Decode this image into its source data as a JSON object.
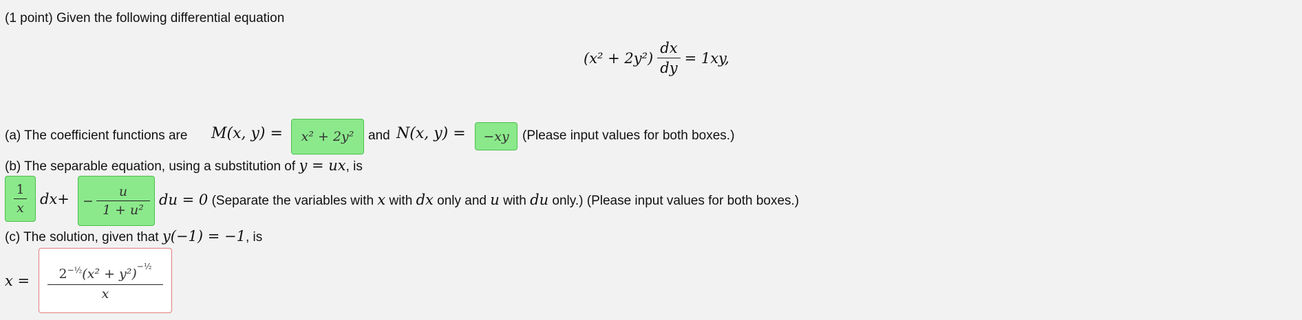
{
  "problem": {
    "intro": "(1 point) Given the following differential equation",
    "equation": {
      "lhs_paren": "(x² + 2y²)",
      "deriv_num": "dx",
      "deriv_den": "dy",
      "rhs": "= 1xy,"
    }
  },
  "part_a": {
    "text_before": "(a) The coefficient functions are",
    "m_label": "M(x, y) =",
    "m_answer": "x² + 2y²",
    "and_text": "and",
    "n_label": "N(x, y) =",
    "n_answer": "−xy",
    "note": "(Please input values for both boxes.)"
  },
  "part_b": {
    "text": "(b) The separable equation, using a substitution of",
    "subst": "y = ux",
    "is_text": ", is",
    "ans1_num": "1",
    "ans1_den": "x",
    "dx_plus": "dx+",
    "ans2_sign": "−",
    "ans2_num": "u",
    "ans2_den": "1 + u²",
    "du_zero": "du = 0",
    "note_prefix": "(Separate the variables with",
    "note_x": "x",
    "note_with1": "with",
    "note_dx": "dx",
    "note_only_and": "only and",
    "note_u": "u",
    "note_with2": "with",
    "note_du": "du",
    "note_suffix": "only.) (Please input values for both boxes.)"
  },
  "part_c": {
    "text": "(c) The solution, given that",
    "condition": "y(−1) = −1",
    "is_text": ", is",
    "x_label": "x =",
    "answer_base": "2",
    "answer_exp1": "−½",
    "answer_paren": "(x² + y²)",
    "answer_exp2": "−½",
    "answer_den": "x"
  },
  "colors": {
    "correct_bg": "#8be98b",
    "correct_border": "#4cbf4c",
    "incorrect_border": "#e07c7c",
    "page_bg": "#f2f2f2"
  }
}
